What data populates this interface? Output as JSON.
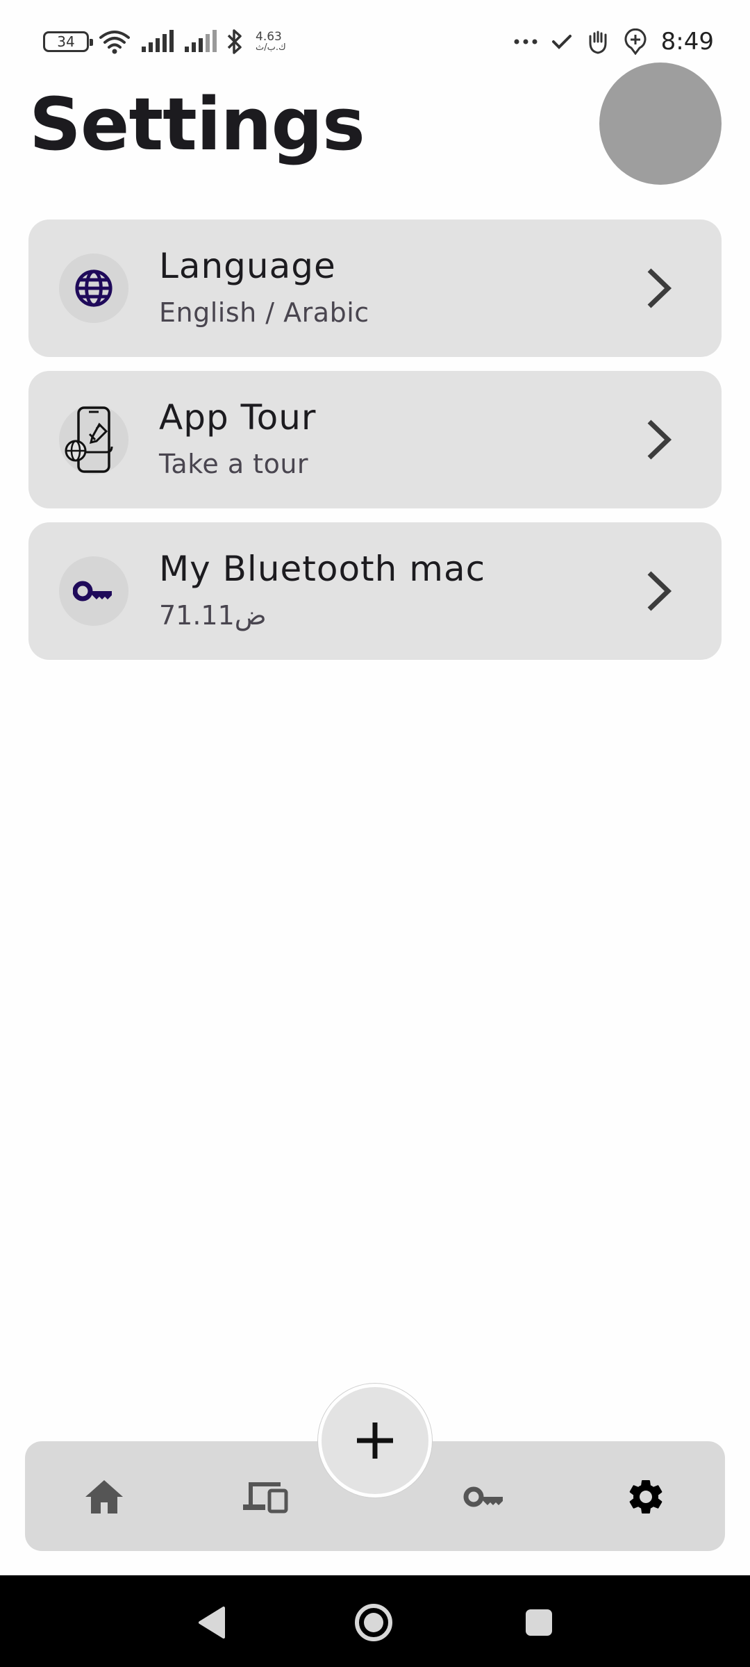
{
  "status_bar": {
    "battery": "34",
    "net_speed_value": "4.63",
    "net_speed_unit": "ك.ب/ث",
    "time": "8:49"
  },
  "header": {
    "title": "Settings"
  },
  "settings": [
    {
      "title": "Language",
      "subtitle": "English / Arabic",
      "icon": "globe-icon"
    },
    {
      "title": "App Tour",
      "subtitle": "Take a tour",
      "icon": "phone-tour-icon"
    },
    {
      "title": "My Bluetooth mac",
      "subtitle": "71.11ض",
      "icon": "key-icon"
    }
  ],
  "bottom_nav": {
    "items": [
      "home-icon",
      "devices-icon",
      "add-icon",
      "key-icon",
      "settings-icon"
    ],
    "active": "settings-icon"
  },
  "colors": {
    "accent_icon": "#1f0a5a",
    "card_bg": "#e2e2e2",
    "nav_bg": "#d9d9d9",
    "avatar": "#9e9e9e"
  }
}
